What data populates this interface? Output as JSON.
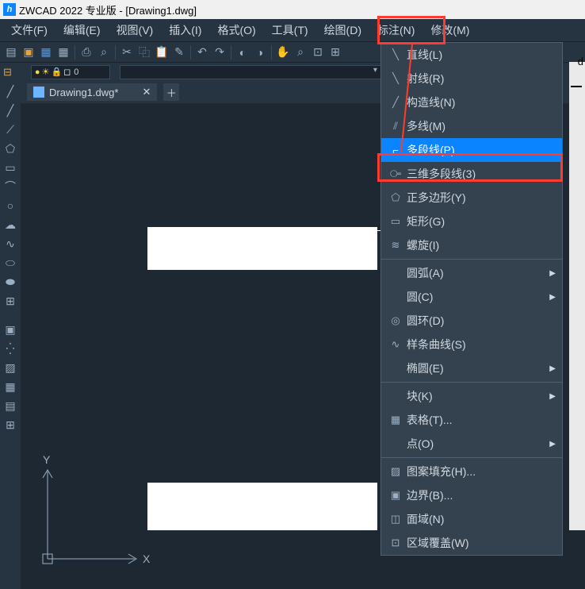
{
  "title": "ZWCAD 2022 专业版 - [Drawing1.dwg]",
  "menu": {
    "file": "文件(F)",
    "edit": "编辑(E)",
    "view": "视图(V)",
    "insert": "插入(I)",
    "format": "格式(O)",
    "tools": "工具(T)",
    "draw": "绘图(D)",
    "dim": "标注(N)",
    "modify": "修改(M)"
  },
  "tabname": "Drawing1.dwg*",
  "layer0": "0",
  "ucs": {
    "x": "X",
    "y": "Y"
  },
  "redge": "d",
  "draw_menu": {
    "line": "直线(L)",
    "ray": "射线(R)",
    "xline": "构造线(N)",
    "mline": "多线(M)",
    "pline": "多段线(P)",
    "pline3d": "三维多段线(3)",
    "polygon": "正多边形(Y)",
    "rect": "矩形(G)",
    "helix": "螺旋(I)",
    "arc": "圆弧(A)",
    "circle": "圆(C)",
    "donut": "圆环(D)",
    "spline": "样条曲线(S)",
    "ellipse": "椭圆(E)",
    "block": "块(K)",
    "table": "表格(T)...",
    "point": "点(O)",
    "hatch": "图案填充(H)...",
    "boundary": "边界(B)...",
    "region": "面域(N)",
    "wipeout": "区域覆盖(W)"
  }
}
